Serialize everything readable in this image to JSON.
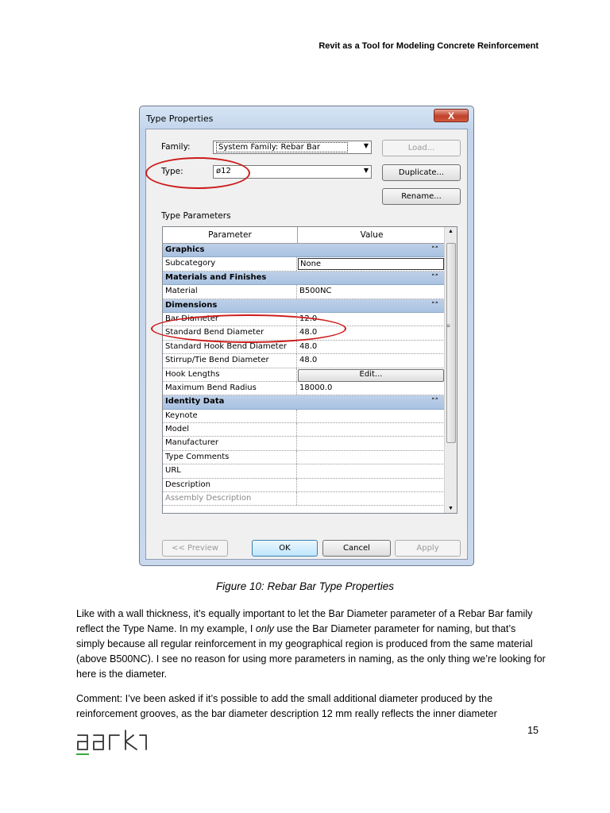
{
  "header": {
    "title": "Revit as a Tool for Modeling Concrete Reinforcement"
  },
  "dialog": {
    "title": "Type Properties",
    "close_label": "X",
    "family_label": "Family:",
    "family_value": "System Family: Rebar Bar",
    "type_label": "Type:",
    "type_value": "ø12",
    "load_label": "Load...",
    "duplicate_label": "Duplicate...",
    "rename_label": "Rename...",
    "section_label": "Type Parameters",
    "col_parameter": "Parameter",
    "col_value": "Value",
    "groups": {
      "graphics": "Graphics",
      "materials": "Materials and Finishes",
      "dimensions": "Dimensions",
      "identity": "Identity Data"
    },
    "params": {
      "subcategory": {
        "name": "Subcategory",
        "value": "None"
      },
      "material": {
        "name": "Material",
        "value": "B500NC"
      },
      "bar_diameter": {
        "name": "Bar Diameter",
        "value": "12.0"
      },
      "std_bend": {
        "name": "Standard Bend Diameter",
        "value": "48.0"
      },
      "std_hook": {
        "name": "Standard Hook Bend Diameter",
        "value": "48.0"
      },
      "stirrup": {
        "name": "Stirrup/Tie Bend Diameter",
        "value": "48.0"
      },
      "hook_lengths": {
        "name": "Hook Lengths",
        "value": "Edit..."
      },
      "max_bend": {
        "name": "Maximum Bend Radius",
        "value": "18000.0"
      },
      "keynote": {
        "name": "Keynote",
        "value": ""
      },
      "model": {
        "name": "Model",
        "value": ""
      },
      "manufacturer": {
        "name": "Manufacturer",
        "value": ""
      },
      "type_comments": {
        "name": "Type Comments",
        "value": ""
      },
      "url": {
        "name": "URL",
        "value": ""
      },
      "description": {
        "name": "Description",
        "value": ""
      },
      "assembly": {
        "name": "Assembly Description",
        "value": ""
      }
    },
    "preview_label": "<< Preview",
    "ok_label": "OK",
    "cancel_label": "Cancel",
    "apply_label": "Apply"
  },
  "caption": "Figure 10: Rebar Bar Type Properties",
  "para1": {
    "before": "Like with a wall thickness, it’s equally important to let the Bar Diameter parameter of a Rebar Bar family reflect the Type Name. In my example, I ",
    "emph": "only",
    "after": " use the Bar Diameter parameter for naming, but that’s simply because all regular reinforcement in my geographical region is produced from the same material (above B500NC). I see no reason for using more parameters in naming, as the only thing we’re looking for here is the diameter."
  },
  "para2": "Comment: I’ve been asked if it’s possible to add the small additional diameter produced by the reinforcement grooves, as the bar diameter description 12 mm really reflects the inner diameter",
  "page_number": "15",
  "logo_text": "dark"
}
